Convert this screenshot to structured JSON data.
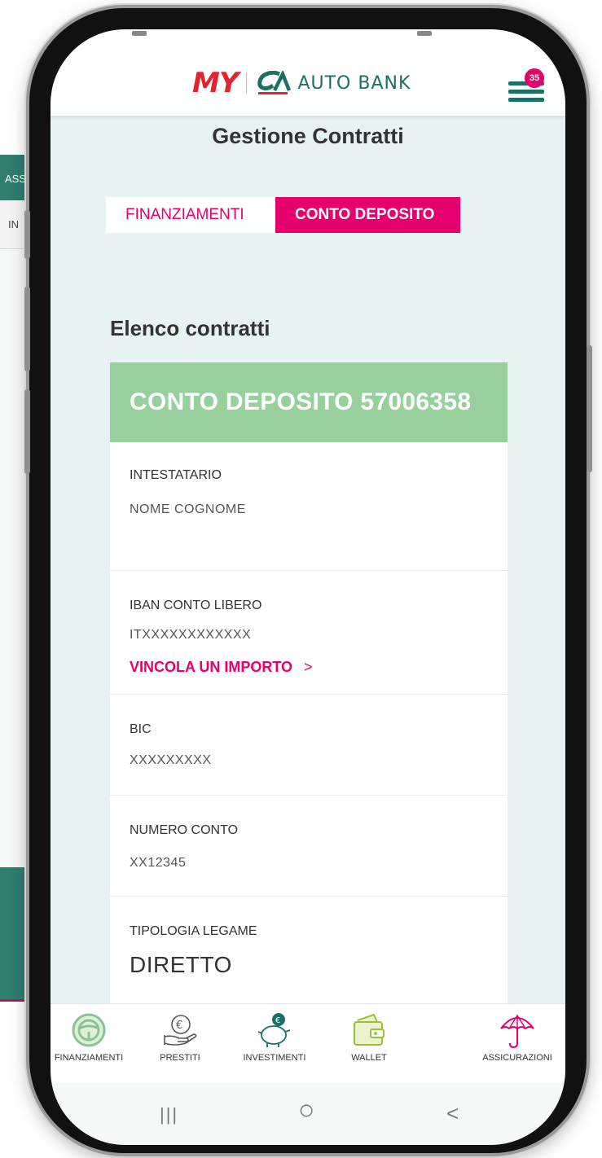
{
  "background_page": {
    "tab_label": "ASS",
    "field_label": "IN"
  },
  "header": {
    "brand_my": "MY",
    "brand_bank": "AUTO BANK",
    "menu_badge": "35"
  },
  "page_title": "Gestione Contratti",
  "tabs": [
    {
      "label": "FINANZIAMENTI",
      "active": false
    },
    {
      "label": "CONTO DEPOSITO",
      "active": true
    }
  ],
  "section_title": "Elenco contratti",
  "contract": {
    "title": "CONTO DEPOSITO 57006358",
    "intestatario_label": "INTESTATARIO",
    "intestatario_value": "NOME COGNOME",
    "iban_label": "IBAN CONTO LIBERO",
    "iban_value": "ITXXXXXXXXXXXX",
    "vincola_label": "VINCOLA UN IMPORTO",
    "vincola_arrow": ">",
    "bic_label": "BIC",
    "bic_value": "XXXXXXXXX",
    "numero_label": "NUMERO CONTO",
    "numero_value": "XX12345",
    "tipologia_label": "TIPOLOGIA LEGAME",
    "tipologia_value": "DIRETTO"
  },
  "bottom_nav": [
    {
      "label": "FINANZIAMENTI",
      "icon": "steering-wheel-icon"
    },
    {
      "label": "PRESTITI",
      "icon": "euro-hand-icon"
    },
    {
      "label": "INVESTIMENTI",
      "icon": "piggy-bank-icon"
    },
    {
      "label": "WALLET",
      "icon": "wallet-icon"
    },
    {
      "label": "ASSICURAZIONI",
      "icon": "umbrella-icon"
    }
  ],
  "system_nav": {
    "recents": "|||",
    "home": "○",
    "back": "<"
  },
  "colors": {
    "brand_pink": "#e5006d",
    "brand_green": "#1b6f63",
    "card_header": "#97cf9d",
    "screen_bg": "#e7f3f2"
  }
}
